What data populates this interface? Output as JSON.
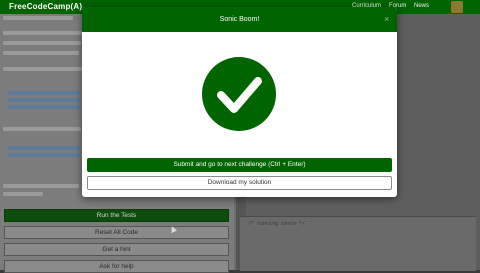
{
  "navbar": {
    "brand": "FreeCodeCamp(A)",
    "links": [
      "Curriculum",
      "Forum",
      "News"
    ]
  },
  "sidebar": {
    "buttons": [
      "Run the Tests",
      "Reset All Code",
      "Get a hint",
      "Ask for help"
    ]
  },
  "output": {
    "text": "/* running tests */"
  },
  "modal": {
    "title": "Sonic Boom!",
    "close_label": "×",
    "submit_label": "Submit and go to next challenge (Ctrl + Enter)",
    "download_label": "Download my solution"
  },
  "colors": {
    "brand": "#006400",
    "white": "#ffffff"
  },
  "icons": {
    "success": "check-circle-icon",
    "close": "close-icon",
    "avatar": "avatar",
    "cursor": "mouse-cursor"
  }
}
